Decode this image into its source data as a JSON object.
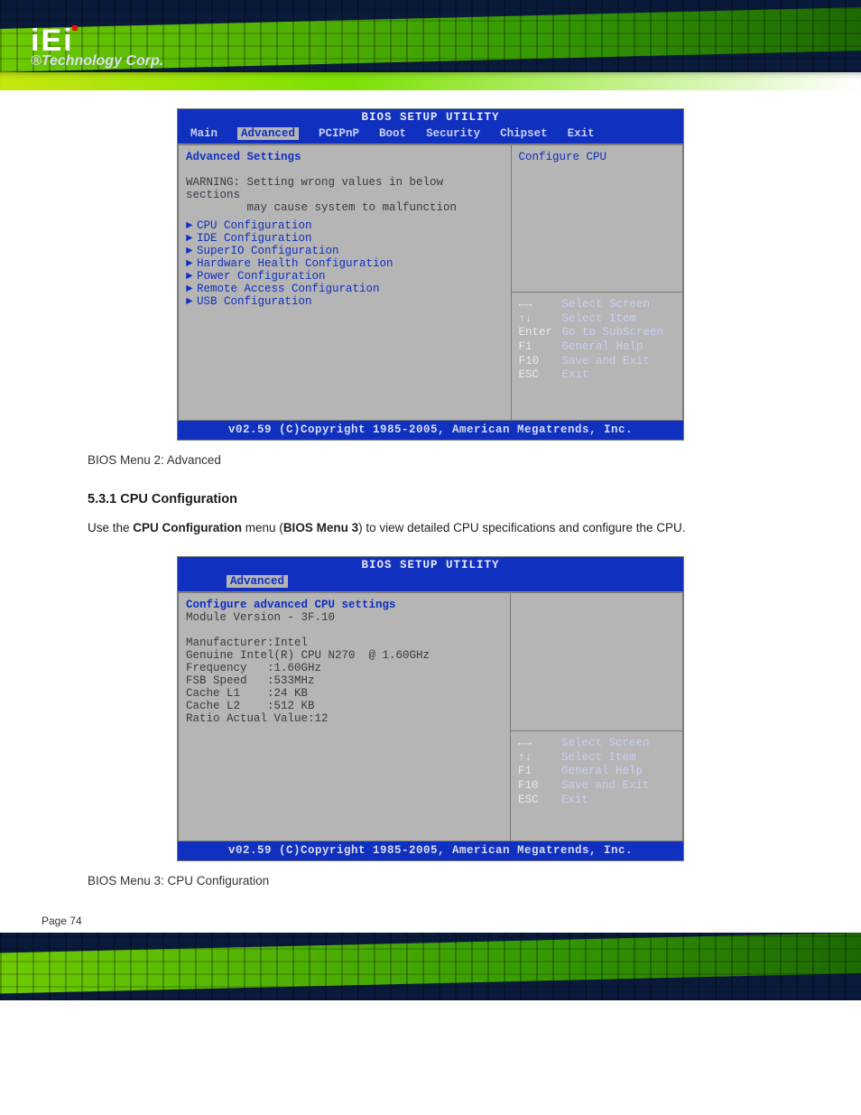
{
  "logo": {
    "name": "iEi",
    "tagline": "®Technology Corp."
  },
  "bios1": {
    "title": "BIOS SETUP UTILITY",
    "menu": [
      "Main",
      "Advanced",
      "PCIPnP",
      "Boot",
      "Security",
      "Chipset",
      "Exit"
    ],
    "active_tab": "Advanced",
    "heading": "Advanced Settings",
    "warning_l1": "WARNING: Setting wrong values in below sections",
    "warning_l2": "         may cause system to malfunction",
    "items": [
      "CPU Configuration",
      "IDE Configuration",
      "SuperIO Configuration",
      "Hardware Health Configuration",
      "Power Configuration",
      "Remote Access Configuration",
      "USB Configuration"
    ],
    "right_desc": "Configure CPU",
    "keys": [
      {
        "k": "←→",
        "v": "Select Screen"
      },
      {
        "k": "↑↓",
        "v": "Select Item"
      },
      {
        "k": "Enter",
        "v": "Go to SubScreen"
      },
      {
        "k": "F1",
        "v": "General Help"
      },
      {
        "k": "F10",
        "v": "Save and Exit"
      },
      {
        "k": "ESC",
        "v": "Exit"
      }
    ],
    "status": "v02.59 (C)Copyright 1985-2005, American Megatrends, Inc."
  },
  "caption1": "BIOS Menu 2: Advanced",
  "section_title": "5.3.1 CPU Configuration",
  "para": {
    "t1": "Use the ",
    "bold1": "CPU Configuration",
    "t2": " menu (",
    "bold2": "BIOS Menu 3",
    "t3": ") to view detailed CPU specifications and configure the CPU."
  },
  "bios2": {
    "title": "BIOS SETUP UTILITY",
    "active_tab": "Advanced",
    "heading": "Configure advanced CPU settings",
    "module_line": "Module Version - 3F.10",
    "lines": [
      "Manufacturer:Intel",
      "Genuine Intel(R) CPU N270  @ 1.60GHz",
      "Frequency   :1.60GHz",
      "FSB Speed   :533MHz",
      "",
      "Cache L1    :24 KB",
      "Cache L2    :512 KB",
      "",
      "Ratio Actual Value:12"
    ],
    "keys": [
      {
        "k": "←→",
        "v": "Select Screen"
      },
      {
        "k": "↑↓",
        "v": "Select Item"
      },
      {
        "k": "F1",
        "v": "General Help"
      },
      {
        "k": "F10",
        "v": "Save and Exit"
      },
      {
        "k": "ESC",
        "v": "Exit"
      }
    ],
    "status": "v02.59 (C)Copyright 1985-2005, American Megatrends, Inc."
  },
  "caption2": "BIOS Menu 3: CPU Configuration",
  "page_number": "Page 74"
}
